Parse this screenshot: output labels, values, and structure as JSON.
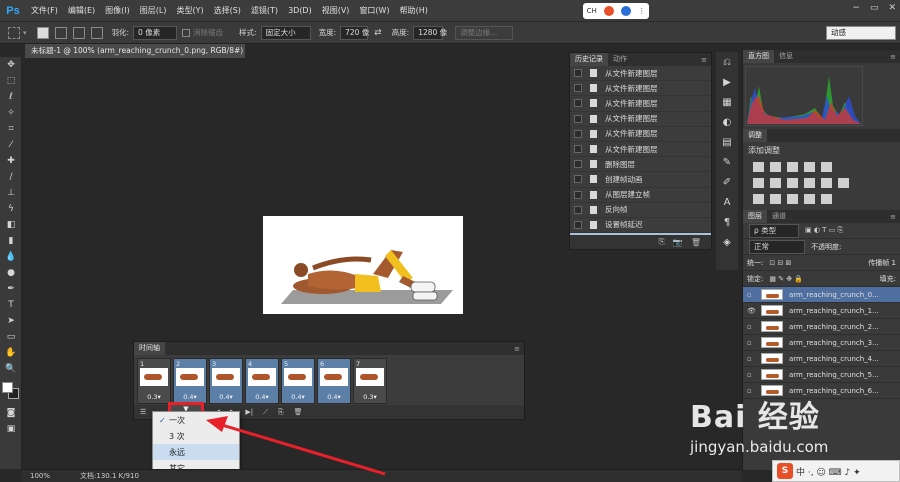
{
  "app": {
    "logo": "Ps",
    "menu": [
      "文件(F)",
      "编辑(E)",
      "图像(I)",
      "图层(L)",
      "类型(Y)",
      "选择(S)",
      "滤镜(T)",
      "3D(D)",
      "视图(V)",
      "窗口(W)",
      "帮助(H)"
    ],
    "tray_text": "CH"
  },
  "options": {
    "feather_label": "羽化:",
    "feather_value": "0 像素",
    "antialias": "消除锯齿",
    "style_label": "样式:",
    "style_value": "固定大小",
    "width_label": "宽度:",
    "width_value": "720 像",
    "height_label": "高度:",
    "height_value": "1280 像",
    "refine": "调整边缘...",
    "workspace": "动感"
  },
  "document": {
    "tab_title": "未标题-1 @ 100% (arm_reaching_crunch_0.png, RGB/8#) *",
    "close": "×"
  },
  "history": {
    "tabs": [
      "历史记录",
      "动作"
    ],
    "items": [
      "从文件新建图层",
      "从文件新建图层",
      "从文件新建图层",
      "从文件新建图层",
      "从文件新建图层",
      "从文件新建图层",
      "删除图层",
      "创建帧动画",
      "从图层建立帧",
      "反向帧",
      "设置帧延迟",
      "设置帧延迟"
    ],
    "active_index": 11
  },
  "right": {
    "hist_tabs": [
      "直方图",
      "信息"
    ],
    "adjust_tab": "调整",
    "adjust_title": "添加调整",
    "layer_tabs": [
      "图层",
      "通道"
    ],
    "kind": "ρ 类型",
    "blend": "正常",
    "opacity_label": "不透明度:",
    "unify": "统一:",
    "propagate": "传播帧 1",
    "lock_label": "锁定:",
    "fill_label": "填充:",
    "layers": [
      "arm_reaching_crunch_0...",
      "arm_reaching_crunch_1...",
      "arm_reaching_crunch_2...",
      "arm_reaching_crunch_3...",
      "arm_reaching_crunch_4...",
      "arm_reaching_crunch_5...",
      "arm_reaching_crunch_6..."
    ],
    "visible_layer": 1,
    "selected_layer": 0
  },
  "timeline": {
    "title": "时间轴",
    "frames": [
      {
        "num": "1",
        "delay": "0.3▾"
      },
      {
        "num": "2",
        "delay": "0.4▾"
      },
      {
        "num": "3",
        "delay": "0.4▾"
      },
      {
        "num": "4",
        "delay": "0.4▾"
      },
      {
        "num": "5",
        "delay": "0.4▾"
      },
      {
        "num": "6",
        "delay": "0.4▾"
      },
      {
        "num": "7",
        "delay": "0.3▾"
      }
    ],
    "selected_frames": [
      1,
      2,
      3,
      4,
      5
    ]
  },
  "loop_menu": {
    "items": [
      "一次",
      "3 次",
      "永远",
      "其它..."
    ],
    "checked_index": 0,
    "hover_index": 2
  },
  "status": {
    "zoom": "100%",
    "doc": "文档:130.1 K/910"
  },
  "watermark": {
    "logo": "Bai 经验",
    "url": "jingyan.baidu.com"
  },
  "ime": {
    "logo": "S",
    "text": "中 ·, ☺ ⌨ ♪ ✦"
  },
  "colors": {
    "accent_red": "#e8202a",
    "selection_blue": "#5c7fa8",
    "history_active": "#a9c0dc"
  }
}
